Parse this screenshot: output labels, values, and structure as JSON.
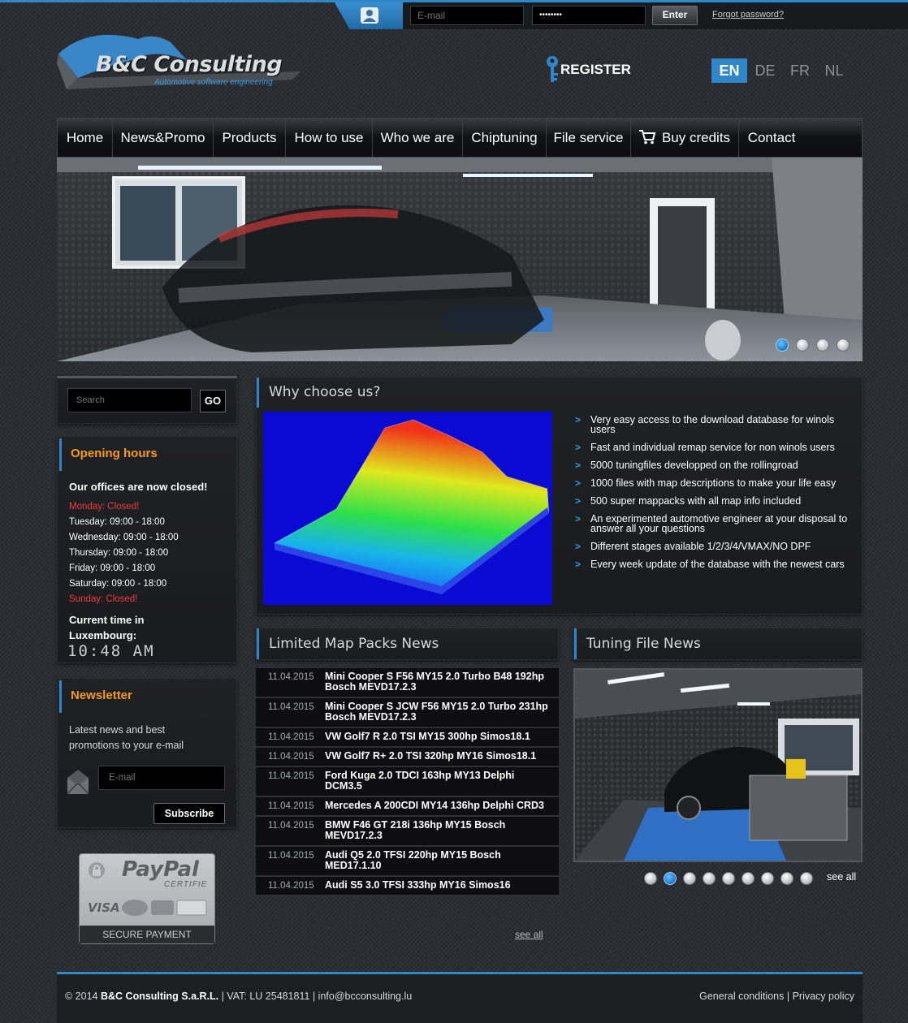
{
  "login": {
    "email_placeholder": "E-mail",
    "password_value": "••••••••",
    "enter_label": "Enter",
    "forgot_label": "Forgot password?"
  },
  "header": {
    "logo_text": "B&C Consulting",
    "logo_tagline": "Automotive software engineering",
    "register_label": "REGISTER",
    "languages": [
      "EN",
      "DE",
      "FR",
      "NL"
    ],
    "active_language": "EN"
  },
  "nav": {
    "items": [
      "Home",
      "News&Promo",
      "Products",
      "How to use",
      "Who we are",
      "Chiptuning",
      "File service",
      "Buy credits",
      "Contact"
    ]
  },
  "search": {
    "placeholder": "Search",
    "go_label": "GO"
  },
  "opening_hours": {
    "title": "Opening hours",
    "status": "Our offices are now closed!",
    "days": [
      "Monday: Closed!",
      "Tuesday: 09:00 - 18:00",
      "Wednesday: 09:00 - 18:00",
      "Thursday: 09:00 - 18:00",
      "Friday: 09:00 - 18:00",
      "Saturday: 09:00 - 18:00",
      "Sunday: Closed!"
    ],
    "time_label_line1": "Current time in",
    "time_label_line2": "Luxembourg:",
    "clock": "10:48 AM"
  },
  "newsletter": {
    "title": "Newsletter",
    "text_line1": "Latest news and best",
    "text_line2": "promotions to your e-mail",
    "email_placeholder": "E-mail",
    "subscribe_label": "Subscribe"
  },
  "paypal": {
    "logo": "PayPal",
    "certified": "CERTIFIE",
    "secure": "SECURE PAYMENT"
  },
  "why": {
    "title": "Why choose us?",
    "items": [
      "Very easy access to the download database for winols users",
      "Fast and individual remap service for non winols users",
      "5000 tuningfiles developped on the rollingroad",
      "1000 files with map descriptions to make your life easy",
      "500 super mappacks with all map info included",
      "An experimented automotive engineer at your disposal to answer all your questions",
      "Different stages available 1/2/3/4/VMAX/NO DPF",
      "Every week update of the database with the newest cars"
    ]
  },
  "map_news": {
    "title": "Limited Map Packs News",
    "items": [
      {
        "date": "11.04.2015",
        "title": "Mini Cooper S F56 MY15 2.0 Turbo B48 192hp Bosch MEVD17.2.3"
      },
      {
        "date": "11.04.2015",
        "title": "Mini Cooper S JCW F56 MY15 2.0 Turbo 231hp Bosch MEVD17.2.3"
      },
      {
        "date": "11.04.2015",
        "title": "VW Golf7 R 2.0 TSI MY15 300hp Simos18.1"
      },
      {
        "date": "11.04.2015",
        "title": "VW Golf7 R+ 2.0 TSI 320hp MY16 Simos18.1"
      },
      {
        "date": "11.04.2015",
        "title": "Ford Kuga 2.0 TDCI 163hp MY13 Delphi DCM3.5"
      },
      {
        "date": "11.04.2015",
        "title": "Mercedes A 200CDI MY14 136hp Delphi CRD3"
      },
      {
        "date": "11.04.2015",
        "title": "BMW F46 GT 218i 136hp MY15 Bosch MEVD17.2.3"
      },
      {
        "date": "11.04.2015",
        "title": "Audi Q5 2.0 TFSI 220hp MY15 Bosch MED17.1.10"
      },
      {
        "date": "11.04.2015",
        "title": "Audi S5 3.0 TFSI 333hp MY16 Simos16"
      }
    ],
    "see_all": "see all"
  },
  "tuning_news": {
    "title": "Tuning File News",
    "see_all": "see all"
  },
  "footer": {
    "copyright": "© 2014",
    "company": "B&C Consulting S.a.R.L.",
    "vat": "| VAT: LU 25481811 | info@bcconsulting.lu",
    "general_conditions": "General conditions",
    "separator": "|",
    "privacy": "Privacy policy"
  },
  "colors": {
    "accent": "#2f86c8",
    "orange_title": "#f39c1a",
    "closed_red": "#ef3b3b"
  }
}
